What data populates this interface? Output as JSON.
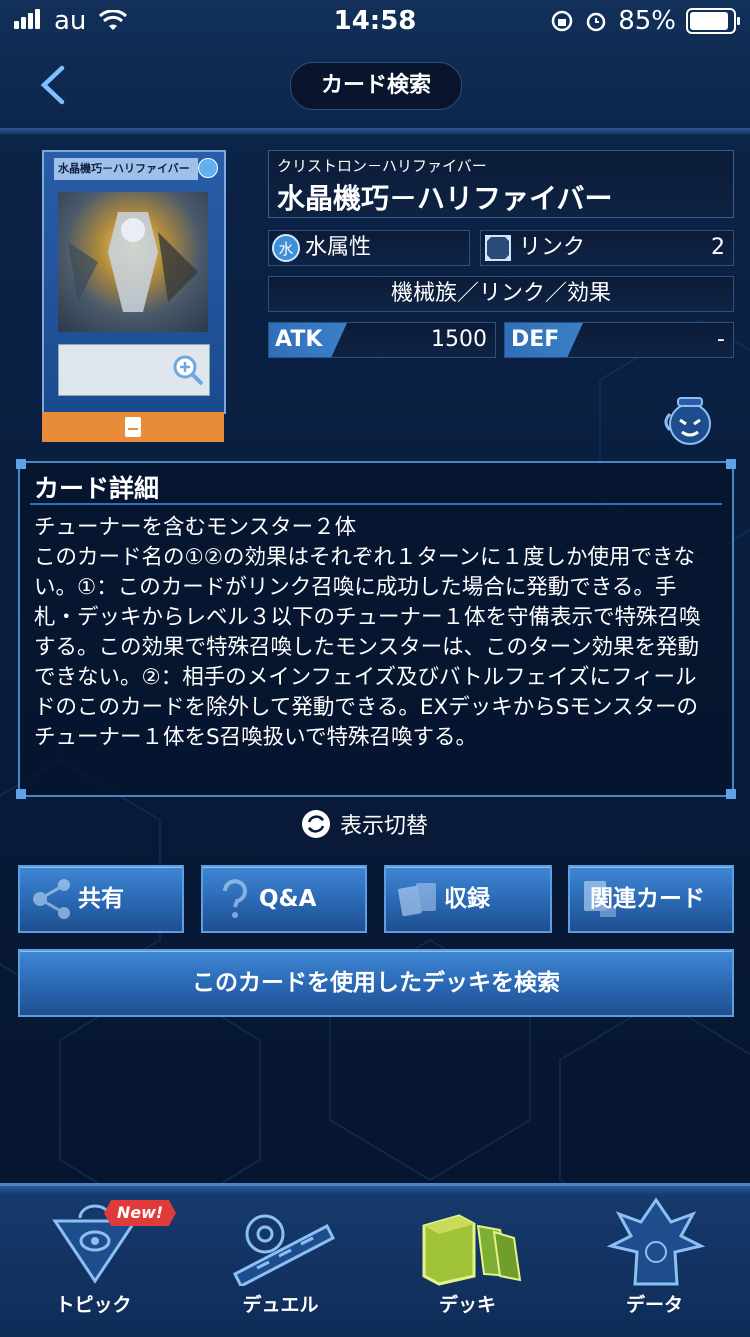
{
  "status_bar": {
    "carrier": "au",
    "time": "14:58",
    "battery": "85%"
  },
  "header": {
    "title": "カード検索"
  },
  "card": {
    "image_title": "水晶機巧－ハリファイバー",
    "reading": "クリストロン－ハリファイバー",
    "name": "水晶機巧－ハリファイバー",
    "attribute": "水属性",
    "link_label": "リンク",
    "link_value": "2",
    "type_line": "機械族／リンク／効果",
    "atk_label": "ATK",
    "atk": "1500",
    "def_label": "DEF",
    "def": "-"
  },
  "detail": {
    "heading": "カード詳細",
    "text": "チューナーを含むモンスター２体\nこのカード名の①②の効果はそれぞれ１ターンに１度しか使用できない。①：このカードがリンク召喚に成功した場合に発動できる。手札・デッキからレベル３以下のチューナー１体を守備表示で特殊召喚する。この効果で特殊召喚したモンスターは、このターン効果を発動できない。②：相手のメインフェイズ及びバトルフェイズにフィールドのこのカードを除外して発動できる。EXデッキからSモンスターのチューナー１体をS召喚扱いで特殊召喚する。"
  },
  "toggle_label": "表示切替",
  "buttons": {
    "share": "共有",
    "qa": "Q&A",
    "recorded": "収録",
    "related": "関連カード",
    "search_decks": "このカードを使用したデッキを検索"
  },
  "nav": {
    "items": [
      {
        "label": "トピック",
        "badge": "New!"
      },
      {
        "label": "デュエル"
      },
      {
        "label": "デッキ"
      },
      {
        "label": "データ"
      }
    ]
  },
  "colors": {
    "accent": "#3f87d4",
    "orange": "#e88c3c",
    "badge_red": "#e03a3a"
  }
}
